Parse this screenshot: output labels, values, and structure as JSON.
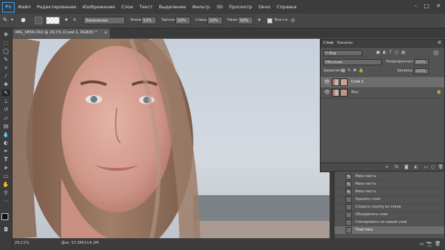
{
  "app": {
    "logo": "Ps"
  },
  "menu": [
    "Файл",
    "Редактирование",
    "Изображение",
    "Слои",
    "Текст",
    "Выделение",
    "Фильтр",
    "3D",
    "Просмотр",
    "Окно",
    "Справка"
  ],
  "options": {
    "mode_value": "Заменение",
    "press_label": "Влаж.:",
    "press_value": "12%",
    "fill_label": "Заполн.:",
    "fill_value": "10%",
    "mix_label": "Смеш.:",
    "mix_value": "10%",
    "flow_label": "Нажм.:",
    "flow_value": "50%",
    "sample_all_label": "Все сл."
  },
  "document": {
    "tab_title": "IMG_0856.CR2 @ 29,1% (Слой 1, RGB/8) *",
    "zoom": "29,11%",
    "doc_info": "Док: 57,0M/114,2M"
  },
  "layers_panel": {
    "tab_layers": "Слои",
    "tab_channels": "Каналы",
    "filter_kind": "Вид",
    "blend_mode": "Обычные",
    "opacity_label": "Непрозрачность:",
    "opacity_value": "100%",
    "lock_label": "Закрепить:",
    "fill_label": "Заливка:",
    "fill_value": "100%",
    "layers": [
      {
        "name": "Слой 1"
      },
      {
        "name": "Фон"
      }
    ]
  },
  "history": {
    "items": [
      "Микс-кисть",
      "Микс-кисть",
      "Микс-кисть",
      "Удалить слой",
      "Создать группу из слоев",
      "Объединить слои",
      "Скопировать на новый слой",
      "Пластика"
    ]
  }
}
